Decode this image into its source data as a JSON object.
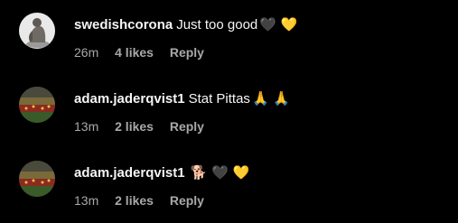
{
  "comments": [
    {
      "username": "swedishcorona",
      "text": "Just too good",
      "emojis": "🖤 💛",
      "time": "26m",
      "likes": "4 likes",
      "reply": "Reply",
      "avatar_icon": "statue-avatar-icon"
    },
    {
      "username": "adam.jaderqvist1",
      "text": "Stat Pittas",
      "emojis": "🙏 🙏",
      "time": "13m",
      "likes": "2 likes",
      "reply": "Reply",
      "avatar_icon": "stadium-avatar-icon"
    },
    {
      "username": "adam.jaderqvist1",
      "text": "",
      "emojis": "🐕 🖤 💛",
      "time": "13m",
      "likes": "2 likes",
      "reply": "Reply",
      "avatar_icon": "stadium-avatar-icon"
    }
  ],
  "colors": {
    "background": "#000000",
    "primary_text": "#f5f5f5",
    "secondary_text": "#a8a8a8"
  }
}
